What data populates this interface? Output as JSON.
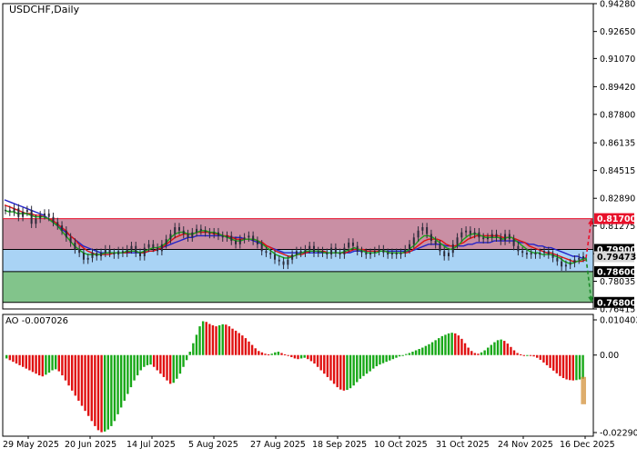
{
  "chart_data": {
    "type": "line",
    "title": "USDCHF,Daily",
    "price_axis": {
      "ylim": [
        0.76415,
        0.9428
      ],
      "ticks": [
        "0.94280",
        "0.92650",
        "0.91070",
        "0.89420",
        "0.87800",
        "0.86135",
        "0.84515",
        "0.82890",
        "0.81275",
        "0.79650",
        "0.78035",
        "0.76415"
      ],
      "tick_values": [
        0.9428,
        0.9265,
        0.9107,
        0.8942,
        0.878,
        0.86135,
        0.84515,
        0.8289,
        0.81275,
        0.7965,
        0.78035,
        0.76415
      ]
    },
    "levels": [
      {
        "value": 0.817,
        "label": "0.81700",
        "color": "#e8102a"
      },
      {
        "value": 0.799,
        "label": "0.79900",
        "color": "#000000"
      },
      {
        "value": 0.79473,
        "label": "0.79473",
        "color": "#d9d9d9"
      },
      {
        "value": 0.786,
        "label": "0.78600",
        "color": "#000000"
      },
      {
        "value": 0.768,
        "label": "0.76800",
        "color": "#000000"
      }
    ],
    "zones": [
      {
        "from": 0.799,
        "to": 0.817,
        "color": "#c98fa4"
      },
      {
        "from": 0.786,
        "to": 0.799,
        "color": "#a9d3f5"
      },
      {
        "from": 0.768,
        "to": 0.786,
        "color": "#82c48b"
      }
    ],
    "x_labels": [
      "29 May 2025",
      "20 Jun 2025",
      "14 Jul 2025",
      "5 Aug 2025",
      "27 Aug 2025",
      "18 Sep 2025",
      "10 Oct 2025",
      "31 Oct 2025",
      "24 Nov 2025",
      "16 Dec 2025"
    ],
    "close_series": [
      0.822,
      0.821,
      0.823,
      0.818,
      0.821,
      0.822,
      0.814,
      0.817,
      0.819,
      0.82,
      0.818,
      0.815,
      0.813,
      0.81,
      0.806,
      0.803,
      0.799,
      0.797,
      0.793,
      0.794,
      0.797,
      0.795,
      0.797,
      0.799,
      0.797,
      0.796,
      0.798,
      0.797,
      0.799,
      0.801,
      0.797,
      0.795,
      0.8,
      0.802,
      0.8,
      0.798,
      0.802,
      0.805,
      0.808,
      0.812,
      0.81,
      0.808,
      0.806,
      0.809,
      0.811,
      0.81,
      0.809,
      0.808,
      0.809,
      0.807,
      0.806,
      0.807,
      0.804,
      0.802,
      0.805,
      0.806,
      0.807,
      0.804,
      0.802,
      0.798,
      0.797,
      0.796,
      0.793,
      0.792,
      0.79,
      0.793,
      0.796,
      0.798,
      0.797,
      0.799,
      0.801,
      0.797,
      0.798,
      0.797,
      0.796,
      0.8,
      0.797,
      0.796,
      0.8,
      0.803,
      0.801,
      0.798,
      0.797,
      0.796,
      0.797,
      0.798,
      0.799,
      0.797,
      0.796,
      0.797,
      0.796,
      0.797,
      0.799,
      0.802,
      0.806,
      0.81,
      0.812,
      0.808,
      0.804,
      0.802,
      0.798,
      0.795,
      0.797,
      0.802,
      0.806,
      0.809,
      0.81,
      0.808,
      0.809,
      0.806,
      0.805,
      0.806,
      0.808,
      0.806,
      0.804,
      0.808,
      0.805,
      0.801,
      0.798,
      0.797,
      0.796,
      0.797,
      0.796,
      0.797,
      0.798,
      0.796,
      0.794,
      0.792,
      0.789,
      0.79,
      0.791,
      0.793,
      0.794,
      0.795
    ],
    "series": [
      {
        "name": "",
        "color": "#2323c8",
        "values": [
          0.828,
          0.827,
          0.826,
          0.825,
          0.824,
          0.823,
          0.822,
          0.821,
          0.82,
          0.819,
          0.817,
          0.815,
          0.813,
          0.811,
          0.809,
          0.807,
          0.805,
          0.803,
          0.801,
          0.8,
          0.799,
          0.798,
          0.797,
          0.797,
          0.797,
          0.797,
          0.797,
          0.797,
          0.797,
          0.797,
          0.797,
          0.797,
          0.797,
          0.798,
          0.798,
          0.799,
          0.8,
          0.801,
          0.802,
          0.803,
          0.804,
          0.805,
          0.806,
          0.806,
          0.807,
          0.807,
          0.807,
          0.807,
          0.807,
          0.807,
          0.807,
          0.806,
          0.806,
          0.806,
          0.806,
          0.805,
          0.805,
          0.804,
          0.803,
          0.802,
          0.801,
          0.8,
          0.799,
          0.798,
          0.797,
          0.797,
          0.797,
          0.797,
          0.797,
          0.797,
          0.797,
          0.797,
          0.797,
          0.797,
          0.797,
          0.797,
          0.797,
          0.797,
          0.797,
          0.797,
          0.798,
          0.798,
          0.798,
          0.798,
          0.798,
          0.798,
          0.798,
          0.798,
          0.798,
          0.798,
          0.798,
          0.798,
          0.798,
          0.798,
          0.799,
          0.8,
          0.801,
          0.802,
          0.802,
          0.802,
          0.802,
          0.801,
          0.801,
          0.801,
          0.801,
          0.801,
          0.802,
          0.802,
          0.803,
          0.803,
          0.803,
          0.803,
          0.804,
          0.804,
          0.804,
          0.804,
          0.804,
          0.804,
          0.803,
          0.803,
          0.802,
          0.802,
          0.801,
          0.801,
          0.8,
          0.8,
          0.799,
          0.798,
          0.797,
          0.796,
          0.795,
          0.795,
          0.794,
          0.794
        ]
      },
      {
        "name": "",
        "color": "#e01010",
        "values": [
          0.825,
          0.824,
          0.823,
          0.822,
          0.821,
          0.82,
          0.82,
          0.819,
          0.819,
          0.818,
          0.817,
          0.816,
          0.814,
          0.812,
          0.81,
          0.807,
          0.805,
          0.802,
          0.8,
          0.798,
          0.797,
          0.796,
          0.796,
          0.796,
          0.796,
          0.797,
          0.797,
          0.797,
          0.797,
          0.798,
          0.798,
          0.797,
          0.797,
          0.798,
          0.798,
          0.799,
          0.8,
          0.802,
          0.804,
          0.806,
          0.807,
          0.808,
          0.808,
          0.808,
          0.809,
          0.809,
          0.809,
          0.809,
          0.808,
          0.808,
          0.807,
          0.807,
          0.806,
          0.805,
          0.805,
          0.805,
          0.805,
          0.805,
          0.804,
          0.803,
          0.801,
          0.8,
          0.798,
          0.797,
          0.796,
          0.795,
          0.795,
          0.796,
          0.796,
          0.797,
          0.798,
          0.798,
          0.798,
          0.798,
          0.797,
          0.797,
          0.797,
          0.797,
          0.797,
          0.798,
          0.799,
          0.799,
          0.799,
          0.798,
          0.798,
          0.798,
          0.798,
          0.798,
          0.797,
          0.797,
          0.797,
          0.797,
          0.797,
          0.798,
          0.8,
          0.802,
          0.804,
          0.805,
          0.805,
          0.805,
          0.804,
          0.802,
          0.801,
          0.801,
          0.802,
          0.803,
          0.805,
          0.806,
          0.807,
          0.807,
          0.807,
          0.807,
          0.807,
          0.807,
          0.806,
          0.806,
          0.806,
          0.805,
          0.804,
          0.803,
          0.801,
          0.8,
          0.799,
          0.798,
          0.797,
          0.797,
          0.796,
          0.795,
          0.794,
          0.793,
          0.792,
          0.792,
          0.792,
          0.793
        ]
      },
      {
        "name": "",
        "color": "#18a818",
        "values": [
          0.822,
          0.821,
          0.821,
          0.82,
          0.82,
          0.82,
          0.819,
          0.818,
          0.818,
          0.818,
          0.817,
          0.815,
          0.813,
          0.81,
          0.807,
          0.804,
          0.801,
          0.799,
          0.797,
          0.796,
          0.796,
          0.796,
          0.796,
          0.797,
          0.797,
          0.797,
          0.797,
          0.797,
          0.798,
          0.798,
          0.798,
          0.797,
          0.798,
          0.799,
          0.8,
          0.8,
          0.801,
          0.803,
          0.806,
          0.808,
          0.809,
          0.809,
          0.808,
          0.808,
          0.809,
          0.81,
          0.81,
          0.809,
          0.809,
          0.808,
          0.807,
          0.806,
          0.805,
          0.804,
          0.804,
          0.805,
          0.805,
          0.805,
          0.804,
          0.802,
          0.8,
          0.798,
          0.796,
          0.795,
          0.794,
          0.794,
          0.795,
          0.796,
          0.797,
          0.798,
          0.798,
          0.798,
          0.798,
          0.797,
          0.797,
          0.797,
          0.797,
          0.797,
          0.798,
          0.799,
          0.8,
          0.799,
          0.798,
          0.797,
          0.797,
          0.797,
          0.798,
          0.798,
          0.797,
          0.797,
          0.797,
          0.797,
          0.798,
          0.8,
          0.802,
          0.805,
          0.807,
          0.807,
          0.806,
          0.804,
          0.802,
          0.8,
          0.799,
          0.8,
          0.802,
          0.805,
          0.807,
          0.808,
          0.808,
          0.807,
          0.806,
          0.806,
          0.806,
          0.806,
          0.805,
          0.806,
          0.806,
          0.804,
          0.802,
          0.8,
          0.798,
          0.797,
          0.797,
          0.796,
          0.796,
          0.796,
          0.795,
          0.794,
          0.792,
          0.791,
          0.791,
          0.792,
          0.793,
          0.794
        ]
      }
    ],
    "forecast_arrows": [
      {
        "direction": "up",
        "target": 0.817,
        "color": "#e8102a"
      },
      {
        "direction": "down",
        "target": 0.768,
        "color": "#1e8a2c"
      }
    ],
    "ao": {
      "label": "AO -0.007026",
      "ylim": [
        -0.022908,
        0.010403
      ],
      "ticks": [
        "0.010403",
        "0.00",
        "-0.022908"
      ],
      "tick_values": [
        0.010403,
        0.0,
        -0.022908
      ],
      "values": [
        -0.001,
        -0.0015,
        -0.002,
        -0.0025,
        -0.003,
        -0.0035,
        -0.004,
        -0.0045,
        -0.005,
        -0.0055,
        -0.006,
        -0.0063,
        -0.0058,
        -0.0052,
        -0.0045,
        -0.0042,
        -0.0048,
        -0.006,
        -0.0075,
        -0.009,
        -0.0105,
        -0.012,
        -0.0135,
        -0.015,
        -0.0165,
        -0.018,
        -0.0195,
        -0.021,
        -0.0222,
        -0.0228,
        -0.0226,
        -0.022,
        -0.021,
        -0.0195,
        -0.0175,
        -0.0155,
        -0.0135,
        -0.0115,
        -0.0095,
        -0.0075,
        -0.006,
        -0.0045,
        -0.0035,
        -0.003,
        -0.0028,
        -0.0035,
        -0.0045,
        -0.0055,
        -0.0065,
        -0.0075,
        -0.0085,
        -0.0082,
        -0.007,
        -0.0055,
        -0.0035,
        -0.0015,
        0.001,
        0.0035,
        0.006,
        0.0085,
        0.01,
        0.0098,
        0.0092,
        0.0088,
        0.0085,
        0.0088,
        0.0091,
        0.009,
        0.0085,
        0.0078,
        0.0072,
        0.0065,
        0.0058,
        0.005,
        0.004,
        0.003,
        0.002,
        0.0012,
        0.0008,
        0.0004,
        0.0002,
        0.0004,
        0.0008,
        0.001,
        0.0006,
        0.0002,
        -0.0002,
        -0.0006,
        -0.001,
        -0.0012,
        -0.001,
        -0.0008,
        -0.0012,
        -0.0018,
        -0.0025,
        -0.0035,
        -0.0045,
        -0.0055,
        -0.0065,
        -0.0075,
        -0.0085,
        -0.0095,
        -0.0102,
        -0.0105,
        -0.0103,
        -0.0098,
        -0.009,
        -0.008,
        -0.007,
        -0.0062,
        -0.0055,
        -0.0048,
        -0.004,
        -0.0033,
        -0.0028,
        -0.0024,
        -0.002,
        -0.0016,
        -0.0012,
        -0.0008,
        -0.0004,
        0.0,
        0.0003,
        0.0006,
        0.001,
        0.0014,
        0.0018,
        0.0022,
        0.0027,
        0.0032,
        0.0038,
        0.0044,
        0.005,
        0.0056,
        0.006,
        0.0064,
        0.0066,
        0.0064,
        0.0058,
        0.0048,
        0.0035,
        0.0022,
        0.0012,
        0.0006,
        0.0004,
        0.0008,
        0.0014,
        0.0022,
        0.003,
        0.0038,
        0.0044,
        0.0046,
        0.0042,
        0.0034,
        0.0024,
        0.0014,
        0.0006,
        0.0002,
        0.0,
        0.0,
        -0.0002,
        -0.0004,
        -0.0008,
        -0.0014,
        -0.0022,
        -0.003,
        -0.0038,
        -0.0046,
        -0.0054,
        -0.0062,
        -0.0068,
        -0.0072,
        -0.0074,
        -0.0075,
        -0.0074,
        -0.0072,
        -0.007
      ]
    }
  }
}
